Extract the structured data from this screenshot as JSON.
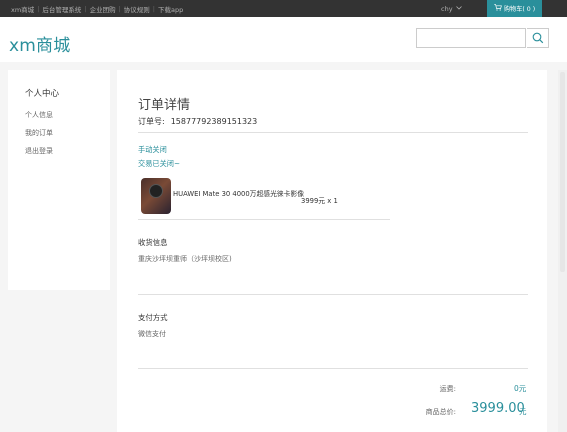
{
  "topbar": {
    "links": [
      "xm商城",
      "后台管理系统",
      "企业团购",
      "协议规则",
      "下载app"
    ],
    "user": "chy",
    "cart_label": "购物车( 0 )"
  },
  "header": {
    "logo": "xm商城",
    "search": {
      "value": "",
      "placeholder": ""
    }
  },
  "sidebar": {
    "title": "个人中心",
    "items": [
      "个人信息",
      "我的订单",
      "退出登录"
    ]
  },
  "order": {
    "title": "订单详情",
    "number_label": "订单号:",
    "number": "15877792389151323",
    "status": "手动关闭",
    "status_detail": "交易已关闭~",
    "product": {
      "name": "HUAWEI Mate 30 4000万超感光徕卡影像",
      "price_qty": "3999元 x 1"
    },
    "shipping": {
      "title": "收货信息",
      "address": "重庆沙坪坝重师（沙坪坝校区)"
    },
    "payment": {
      "title": "支付方式",
      "method": "微信支付"
    },
    "summary": {
      "shipping_label": "运费:",
      "shipping_fee": "0元",
      "total_label": "商品总价:",
      "total_amount": "3999.00",
      "total_unit": "元"
    }
  },
  "colors": {
    "accent": "#2a8f9b",
    "topbar": "#333333"
  },
  "icons": [
    "cart-icon",
    "search-icon",
    "chevron-down-icon"
  ]
}
